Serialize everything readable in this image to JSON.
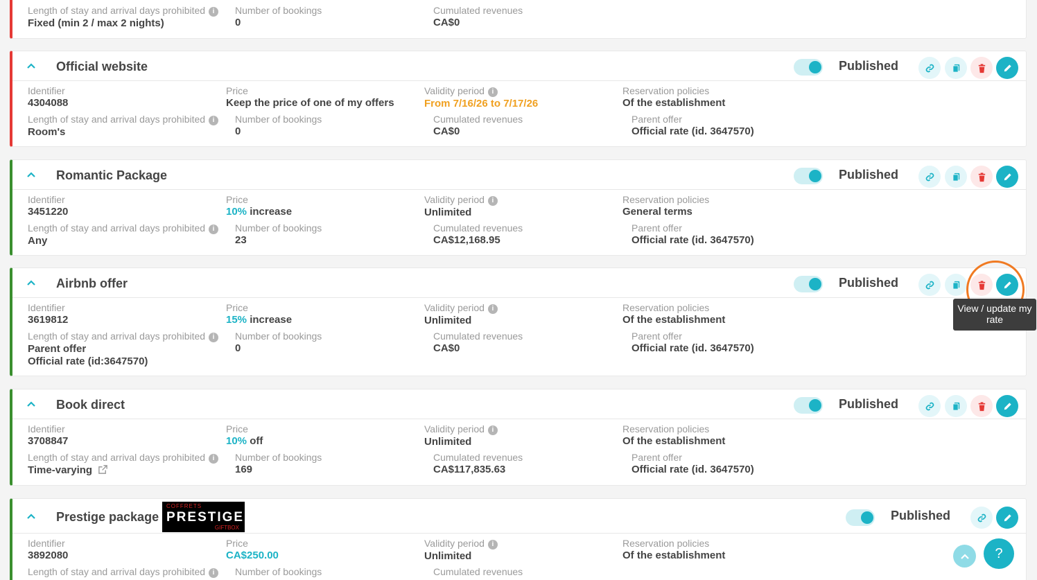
{
  "colors": {
    "teal": "#1cb3c6",
    "red": "#e53935",
    "green": "#3a8f2f",
    "orange": "#f0a020",
    "highlight": "#f07a22"
  },
  "labels": {
    "identifier": "Identifier",
    "price": "Price",
    "validity": "Validity period",
    "policies": "Reservation policies",
    "los": "Length of stay and arrival days prohibited",
    "bookings": "Number of bookings",
    "revenues": "Cumulated revenues",
    "parent": "Parent offer"
  },
  "top_card": {
    "los_value": "Fixed (min 2 / max 2 nights)",
    "bookings": "0",
    "revenues": "CA$0"
  },
  "offers": [
    {
      "title": "Official website",
      "status": "Published",
      "identifier": "4304088",
      "price_text": "Keep the price of one of my offers",
      "validity": "From 7/16/26 to 7/17/26",
      "policies": "Of the establishment",
      "los": "Room's",
      "bookings": "0",
      "revenues": "CA$0",
      "parent": "Official rate (id. 3647570)"
    },
    {
      "title": "Romantic Package",
      "status": "Published",
      "identifier": "3451220",
      "price_amount": "10%",
      "price_suffix": " increase",
      "validity": "Unlimited",
      "policies": "General terms",
      "los": "Any",
      "bookings": "23",
      "revenues": "CA$12,168.95",
      "parent": "Official rate (id. 3647570)"
    },
    {
      "title": "Airbnb offer",
      "status": "Published",
      "identifier": "3619812",
      "price_amount": "15%",
      "price_suffix": " increase",
      "validity": "Unlimited",
      "policies": "Of the establishment",
      "los_parent_label": "Parent offer",
      "los_parent_value": "Official rate (id:3647570)",
      "bookings": "0",
      "revenues": "CA$0",
      "parent": "Official rate (id. 3647570)"
    },
    {
      "title": "Book direct",
      "status": "Published",
      "identifier": "3708847",
      "price_amount": "10%",
      "price_suffix": " off",
      "validity": "Unlimited",
      "policies": "Of the establishment",
      "los": "Time-varying",
      "bookings": "169",
      "revenues": "CA$117,835.63",
      "parent": "Official rate (id. 3647570)"
    },
    {
      "title": "Prestige package",
      "status": "Published",
      "identifier": "3892080",
      "price_amount": "CA$250.00",
      "validity": "Unlimited",
      "policies": "Of the establishment",
      "logo": {
        "line1": "COFFRETS",
        "line2": "PRESTIGE",
        "line3": "GIFTBOX"
      }
    }
  ],
  "tooltip": "View / update my rate",
  "help_label": "?",
  "icons": {
    "chevron": "chevron-up-icon",
    "link": "link-icon",
    "copy": "copy-icon",
    "delete": "trash-icon",
    "edit": "pencil-icon",
    "info": "info-icon",
    "external": "external-link-icon",
    "scroll_top": "chevron-up-icon"
  }
}
